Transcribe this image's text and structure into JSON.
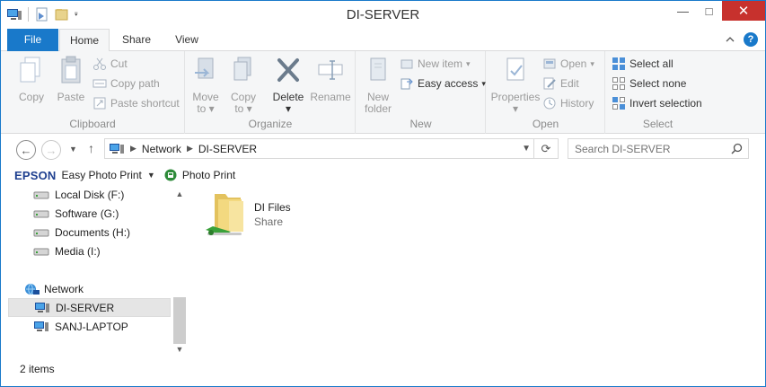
{
  "window": {
    "title": "DI-SERVER",
    "minimize": "—",
    "maximize": "□",
    "close": "✕"
  },
  "ribbon_tabs": [
    "File",
    "Home",
    "Share",
    "View"
  ],
  "ribbon": {
    "clipboard": {
      "label": "Clipboard",
      "copy": "Copy",
      "paste": "Paste",
      "cut": "Cut",
      "copy_path": "Copy path",
      "paste_shortcut": "Paste shortcut"
    },
    "organize": {
      "label": "Organize",
      "move_to_1": "Move",
      "move_to_2": "to",
      "copy_to_1": "Copy",
      "copy_to_2": "to",
      "delete": "Delete",
      "rename": "Rename"
    },
    "new": {
      "label": "New",
      "new_folder_1": "New",
      "new_folder_2": "folder",
      "new_item": "New item",
      "easy_access": "Easy access"
    },
    "open": {
      "label": "Open",
      "properties": "Properties",
      "open": "Open",
      "edit": "Edit",
      "history": "History"
    },
    "select": {
      "label": "Select",
      "select_all": "Select all",
      "select_none": "Select none",
      "invert_selection": "Invert selection"
    }
  },
  "address": {
    "crumbs": [
      "Network",
      "DI-SERVER"
    ],
    "search_placeholder": "Search DI-SERVER"
  },
  "epson_bar": {
    "brand": "EPSON",
    "easy_photo_print": "Easy Photo Print",
    "photo_print": "Photo Print"
  },
  "nav": {
    "items": [
      {
        "label": "Local Disk (F:)",
        "icon": "drive-icon"
      },
      {
        "label": "Software (G:)",
        "icon": "drive-icon"
      },
      {
        "label": "Documents (H:)",
        "icon": "drive-icon"
      },
      {
        "label": "Media (I:)",
        "icon": "drive-icon"
      }
    ],
    "network": "Network",
    "computers": [
      {
        "label": "DI-SERVER",
        "selected": true
      },
      {
        "label": "SANJ-LAPTOP",
        "selected": false
      }
    ]
  },
  "content": {
    "items": [
      {
        "name": "DI Files",
        "type": "Share"
      }
    ]
  },
  "status": {
    "count": "2 items"
  },
  "colors": {
    "accent": "#1979ca",
    "close": "#c7312d",
    "ribbon_bg": "#f5f6f7"
  }
}
